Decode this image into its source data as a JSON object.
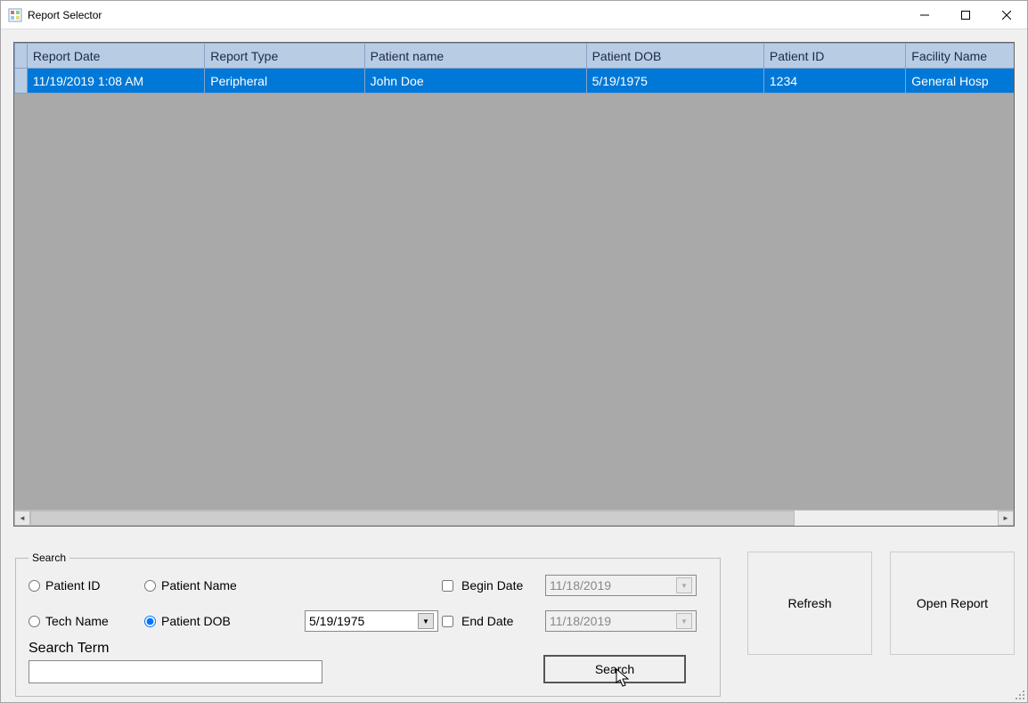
{
  "window": {
    "title": "Report Selector"
  },
  "grid": {
    "columns": [
      "Report Date",
      "Report Type",
      "Patient name",
      "Patient DOB",
      "Patient ID",
      "Facility Name"
    ],
    "rows": [
      {
        "report_date": "11/19/2019 1:08 AM",
        "report_type": "Peripheral",
        "patient_name": "John Doe",
        "patient_dob": "5/19/1975",
        "patient_id": "1234",
        "facility_name": "General Hosp"
      }
    ]
  },
  "search": {
    "legend": "Search",
    "radios": {
      "patient_id": "Patient ID",
      "patient_name": "Patient Name",
      "tech_name": "Tech Name",
      "patient_dob": "Patient DOB"
    },
    "dob_combo": "5/19/1975",
    "begin_date_label": "Begin Date",
    "begin_date_value": "11/18/2019",
    "end_date_label": "End Date",
    "end_date_value": "11/18/2019",
    "search_term_label": "Search Term",
    "search_term_value": "",
    "search_button": "Search"
  },
  "buttons": {
    "refresh": "Refresh",
    "open_report": "Open Report"
  }
}
